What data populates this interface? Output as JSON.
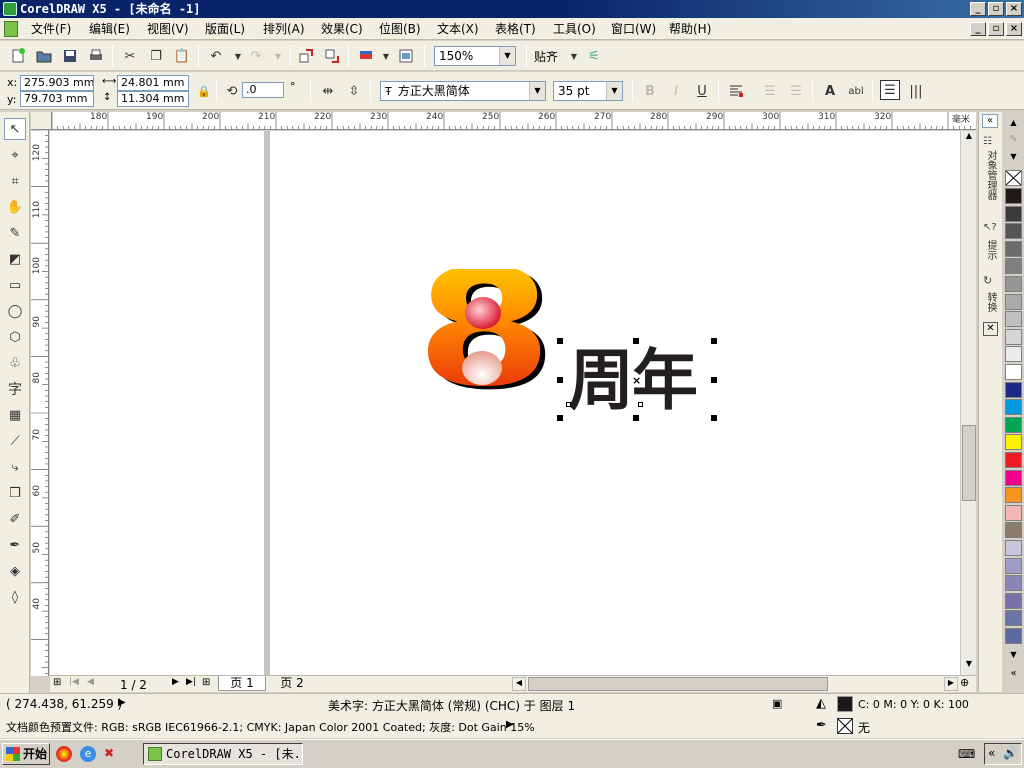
{
  "window": {
    "title": "CorelDRAW X5 - [未命名 -1]"
  },
  "menu": [
    "文件(F)",
    "编辑(E)",
    "视图(V)",
    "版面(L)",
    "排列(A)",
    "效果(C)",
    "位图(B)",
    "文本(X)",
    "表格(T)",
    "工具(O)",
    "窗口(W)",
    "帮助(H)"
  ],
  "toolbar": {
    "zoom": "150%",
    "snap_label": "贴齐"
  },
  "property_bar": {
    "x_label": "x:",
    "x_value": "275.903 mm",
    "y_label": "y:",
    "y_value": "79.703 mm",
    "width_value": "24.801 mm",
    "height_value": "11.304 mm",
    "rotation_value": ".0",
    "rotation_unit": "°",
    "font_name": "方正大黑简体",
    "font_size": "35 pt",
    "font_icon": "Ŧ"
  },
  "rulers": {
    "unit": "毫米",
    "h_ticks": [
      "180",
      "190",
      "200",
      "210",
      "220",
      "230",
      "240",
      "250",
      "260",
      "270",
      "280",
      "290",
      "300",
      "310",
      "320"
    ],
    "v_ticks": [
      "120",
      "110",
      "100",
      "90",
      "80",
      "70",
      "60",
      "50",
      "40"
    ]
  },
  "canvas": {
    "digit": "8",
    "text": "周年"
  },
  "pages": {
    "indicator": "1 / 2",
    "tabs": [
      "页 1",
      "页 2"
    ]
  },
  "dockers": {
    "labels": [
      "对象管理器",
      "提示",
      "转换"
    ]
  },
  "status": {
    "cursor": "( 274.438, 61.259 )",
    "object_info": "美术字: 方正大黑简体 (常规) (CHC) 于 图层 1",
    "color_profile": "文档颜色预置文件: RGB: sRGB IEC61966-2.1; CMYK: Japan Color 2001 Coated; 灰度: Dot Gain 15%",
    "fill_info": "C: 0 M: 0 Y: 0 K: 100",
    "outline_info": "无"
  },
  "taskbar": {
    "start_label": "开始",
    "task_label": "CorelDRAW X5 - [未..."
  },
  "palette": {
    "colors": [
      "#1f1a17",
      "#3b3b3b",
      "#555555",
      "#6b6b6b",
      "#808080",
      "#969696",
      "#aaaaaa",
      "#c0c0c0",
      "#d6d6d6",
      "#ebebeb",
      "#ffffff",
      "#1c2a86",
      "#0099dd",
      "#00a651",
      "#fff200",
      "#ed1c24",
      "#ec008c",
      "#f7941d",
      "#f4b6b6",
      "#8c7a6b",
      "#c9c5dd",
      "#a09cc8",
      "#8a86b8",
      "#7771a8",
      "#6a73a6",
      "#596b9c"
    ]
  }
}
